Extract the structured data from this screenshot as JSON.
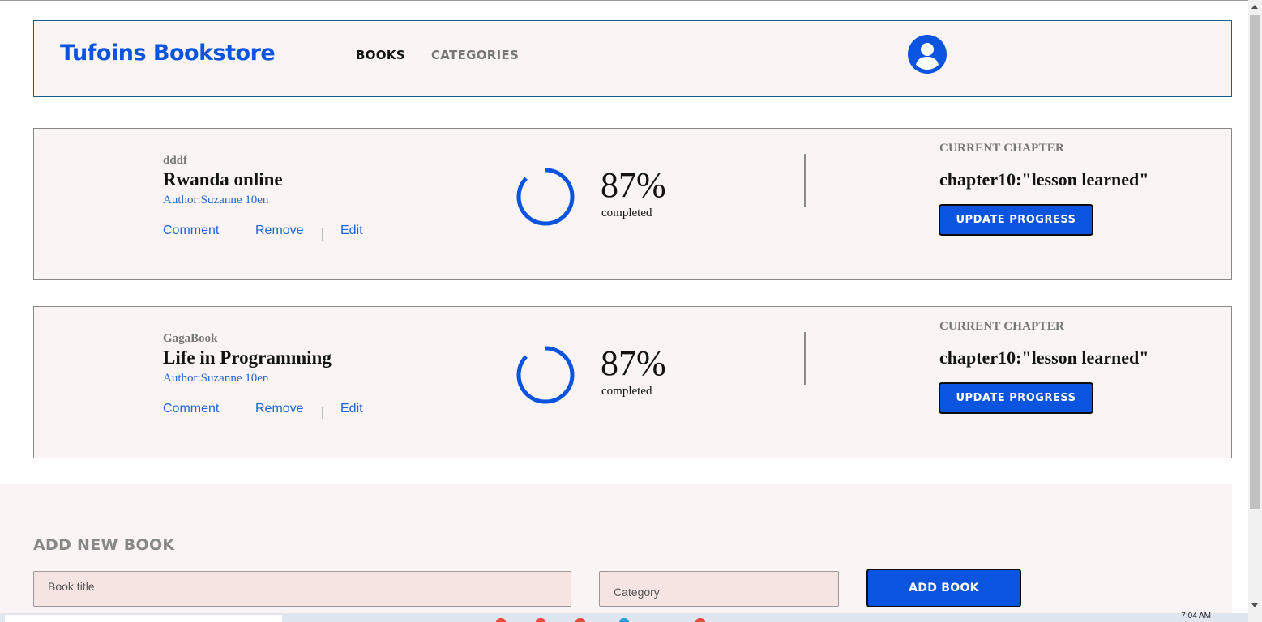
{
  "header": {
    "brand": "Tufoins Bookstore",
    "nav": {
      "books": "BOOKS",
      "categories": "CATEGORIES"
    },
    "avatar_icon": "user-profile-icon"
  },
  "books": [
    {
      "genre": "dddf",
      "title": "Rwanda online",
      "author": "Author:Suzanne 10en",
      "actions": {
        "comment": "Comment",
        "remove": "Remove",
        "edit": "Edit"
      },
      "progress_percent": "87%",
      "progress_value": 0.87,
      "completed_label": "completed",
      "current_chapter_label": "CURRENT CHAPTER",
      "chapter": "chapter10:\"lesson learned\"",
      "update_button": "UPDATE PROGRESS"
    },
    {
      "genre": "GagaBook",
      "title": "Life in Programming",
      "author": "Author:Suzanne 10en",
      "actions": {
        "comment": "Comment",
        "remove": "Remove",
        "edit": "Edit"
      },
      "progress_percent": "87%",
      "progress_value": 0.87,
      "completed_label": "completed",
      "current_chapter_label": "CURRENT CHAPTER",
      "chapter": "chapter10:\"lesson learned\"",
      "update_button": "UPDATE PROGRESS"
    }
  ],
  "add_book": {
    "heading": "ADD NEW BOOK",
    "title_placeholder": "Book title",
    "title_value": "",
    "category_placeholder": "Category",
    "category_value": "",
    "submit_label": "ADD BOOK"
  },
  "taskbar": {
    "clock": "7:04 AM"
  },
  "colors": {
    "accent": "#0b54e0",
    "panel_bg": "#faf4f4",
    "input_bg": "#f5e4e2",
    "link": "#2065d8",
    "muted": "#777777"
  }
}
